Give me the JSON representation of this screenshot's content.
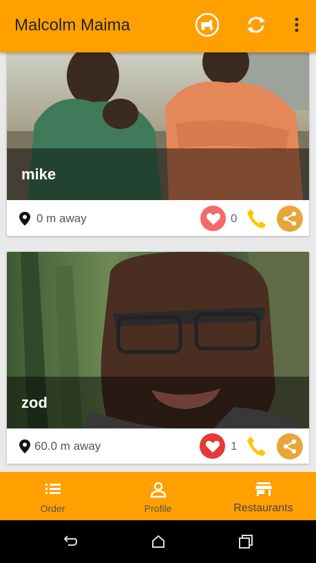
{
  "appbar": {
    "title": "Malcolm Maima",
    "actions": [
      "scooter-icon",
      "refresh-icon",
      "more-vert-icon"
    ]
  },
  "cards": [
    {
      "name": "mike",
      "distance": "0 m away",
      "likes": "0",
      "liked": false
    },
    {
      "name": "zod",
      "distance": "60.0 m away",
      "likes": "1",
      "liked": true
    }
  ],
  "bottom_nav": {
    "items": [
      {
        "label": "Order",
        "icon": "list-icon"
      },
      {
        "label": "Profile",
        "icon": "person-icon"
      },
      {
        "label": "Restaurants",
        "icon": "store-icon",
        "active": true
      }
    ]
  },
  "system_nav": [
    "back-icon",
    "home-icon",
    "recents-icon"
  ],
  "colors": {
    "accent": "#ffa000",
    "heart_unliked_bg": "#f36b6b",
    "heart_liked_bg": "#e53935",
    "phone": "#ffc400",
    "share_bg": "#e8a63a"
  }
}
